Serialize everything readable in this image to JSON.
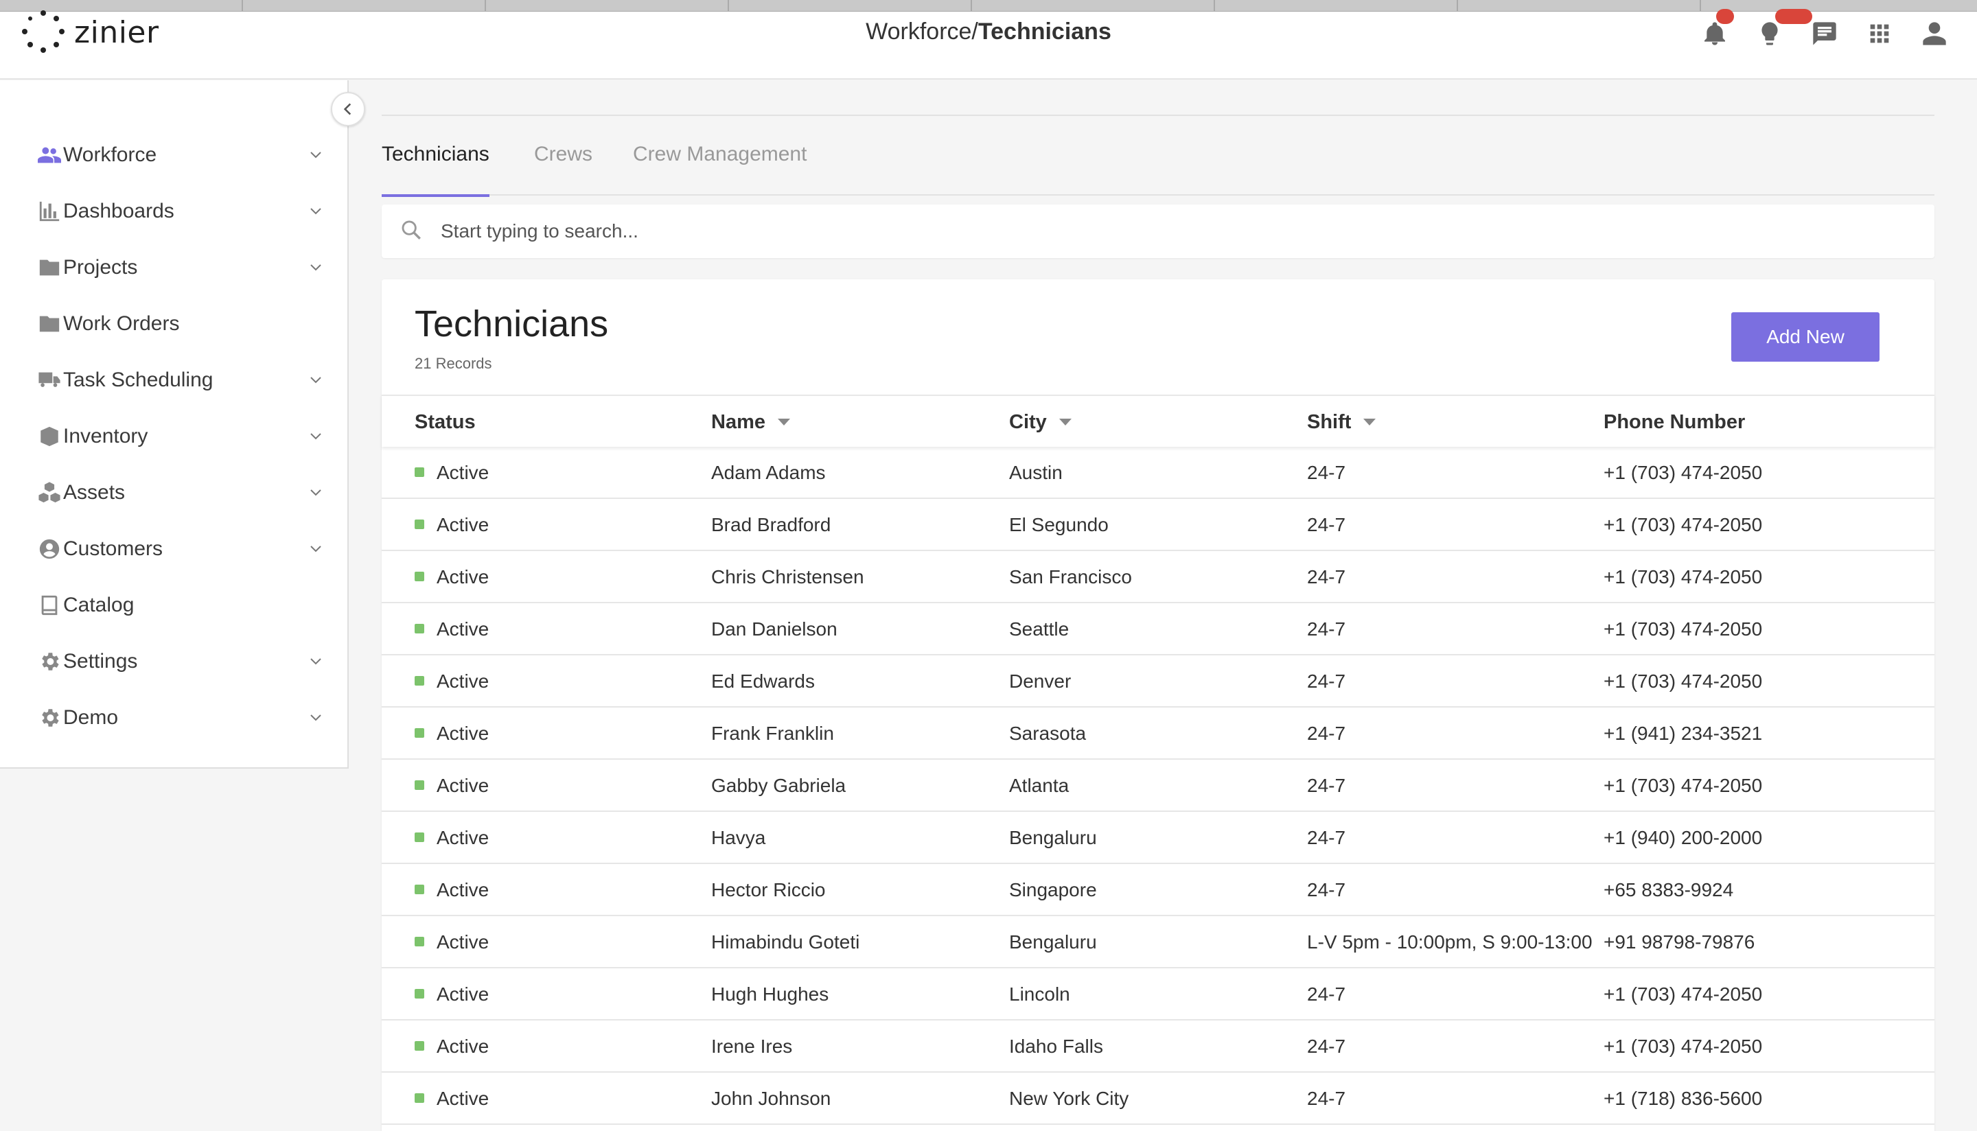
{
  "app": {
    "logo_text": "zinier"
  },
  "header": {
    "breadcrumb_parent": "Workforce/",
    "breadcrumb_current": "Technicians",
    "icons": [
      "bell-icon",
      "lightbulb-icon",
      "chat-icon",
      "apps-grid-icon",
      "user-icon"
    ]
  },
  "sidebar": {
    "items": [
      {
        "label": "Workforce",
        "icon": "users-icon",
        "expandable": true,
        "active": true
      },
      {
        "label": "Dashboards",
        "icon": "bar-chart-icon",
        "expandable": true
      },
      {
        "label": "Projects",
        "icon": "folder-icon",
        "expandable": true
      },
      {
        "label": "Work Orders",
        "icon": "folder-icon",
        "expandable": false
      },
      {
        "label": "Task Scheduling",
        "icon": "truck-icon",
        "expandable": true
      },
      {
        "label": "Inventory",
        "icon": "box-icon",
        "expandable": true
      },
      {
        "label": "Assets",
        "icon": "cubes-icon",
        "expandable": true
      },
      {
        "label": "Customers",
        "icon": "user-circle-icon",
        "expandable": true
      },
      {
        "label": "Catalog",
        "icon": "book-icon",
        "expandable": false
      },
      {
        "label": "Settings",
        "icon": "gear-icon",
        "expandable": true
      },
      {
        "label": "Demo",
        "icon": "gear-icon",
        "expandable": true
      }
    ]
  },
  "tabs": [
    {
      "label": "Technicians",
      "active": true
    },
    {
      "label": "Crews",
      "active": false
    },
    {
      "label": "Crew Management",
      "active": false
    }
  ],
  "search": {
    "placeholder": "Start typing to search..."
  },
  "table": {
    "title": "Technicians",
    "record_count": "21 Records",
    "add_button": "Add New",
    "columns": [
      "Status",
      "Name",
      "City",
      "Shift",
      "Phone Number"
    ],
    "rows": [
      {
        "status": "Active",
        "name": "Adam Adams",
        "city": "Austin",
        "shift": "24-7",
        "phone": "+1 (703) 474-2050"
      },
      {
        "status": "Active",
        "name": "Brad Bradford",
        "city": "El Segundo",
        "shift": "24-7",
        "phone": "+1 (703) 474-2050"
      },
      {
        "status": "Active",
        "name": "Chris Christensen",
        "city": "San Francisco",
        "shift": "24-7",
        "phone": "+1 (703) 474-2050"
      },
      {
        "status": "Active",
        "name": "Dan Danielson",
        "city": "Seattle",
        "shift": "24-7",
        "phone": "+1 (703) 474-2050"
      },
      {
        "status": "Active",
        "name": "Ed Edwards",
        "city": "Denver",
        "shift": "24-7",
        "phone": "+1 (703) 474-2050"
      },
      {
        "status": "Active",
        "name": "Frank Franklin",
        "city": "Sarasota",
        "shift": "24-7",
        "phone": "+1 (941) 234-3521"
      },
      {
        "status": "Active",
        "name": "Gabby Gabriela",
        "city": "Atlanta",
        "shift": "24-7",
        "phone": "+1 (703) 474-2050"
      },
      {
        "status": "Active",
        "name": "Havya",
        "city": "Bengaluru",
        "shift": "24-7",
        "phone": "+1 (940) 200-2000"
      },
      {
        "status": "Active",
        "name": "Hector Riccio",
        "city": "Singapore",
        "shift": "24-7",
        "phone": "+65 8383-9924"
      },
      {
        "status": "Active",
        "name": "Himabindu Goteti",
        "city": "Bengaluru",
        "shift": "L-V 5pm - 10:00pm, S 9:00-13:00",
        "phone": "+91 98798-79876"
      },
      {
        "status": "Active",
        "name": "Hugh Hughes",
        "city": "Lincoln",
        "shift": "24-7",
        "phone": "+1 (703) 474-2050"
      },
      {
        "status": "Active",
        "name": "Irene Ires",
        "city": "Idaho Falls",
        "shift": "24-7",
        "phone": "+1 (703) 474-2050"
      },
      {
        "status": "Active",
        "name": "John Johnson",
        "city": "New York City",
        "shift": "24-7",
        "phone": "+1 (718) 836-5600"
      }
    ]
  },
  "colors": {
    "accent": "#7b6fe0",
    "status_active": "#7cc36b"
  }
}
